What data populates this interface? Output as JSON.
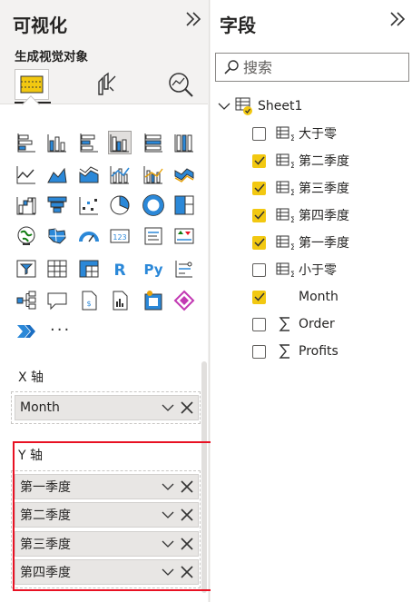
{
  "viz_pane": {
    "title": "可视化",
    "collapse_icon": "double-chevron-right",
    "subtitle": "生成视觉对象",
    "more_label": "···",
    "x_axis": {
      "label": "X 轴",
      "fields": [
        "Month"
      ]
    },
    "y_axis": {
      "label": "Y 轴",
      "fields": [
        "第一季度",
        "第二季度",
        "第三季度",
        "第四季度"
      ]
    },
    "highlight_color": "#e81123"
  },
  "fields_pane": {
    "title": "字段",
    "collapse_icon": "double-chevron-right",
    "search_placeholder": "搜索",
    "table": {
      "name": "Sheet1",
      "expanded": true
    },
    "fields": [
      {
        "name": "大于零",
        "checked": false,
        "icon": "calculated-column-icon"
      },
      {
        "name": "第二季度",
        "checked": true,
        "icon": "calculated-column-icon"
      },
      {
        "name": "第三季度",
        "checked": true,
        "icon": "calculated-column-icon"
      },
      {
        "name": "第四季度",
        "checked": true,
        "icon": "calculated-column-icon"
      },
      {
        "name": "第一季度",
        "checked": true,
        "icon": "calculated-column-icon"
      },
      {
        "name": "小于零",
        "checked": false,
        "icon": "calculated-column-icon"
      },
      {
        "name": "Month",
        "checked": true,
        "icon": "none"
      },
      {
        "name": "Order",
        "checked": false,
        "icon": "sigma-icon"
      },
      {
        "name": "Profits",
        "checked": false,
        "icon": "sigma-icon"
      }
    ],
    "accent_color": "#f2c811"
  }
}
